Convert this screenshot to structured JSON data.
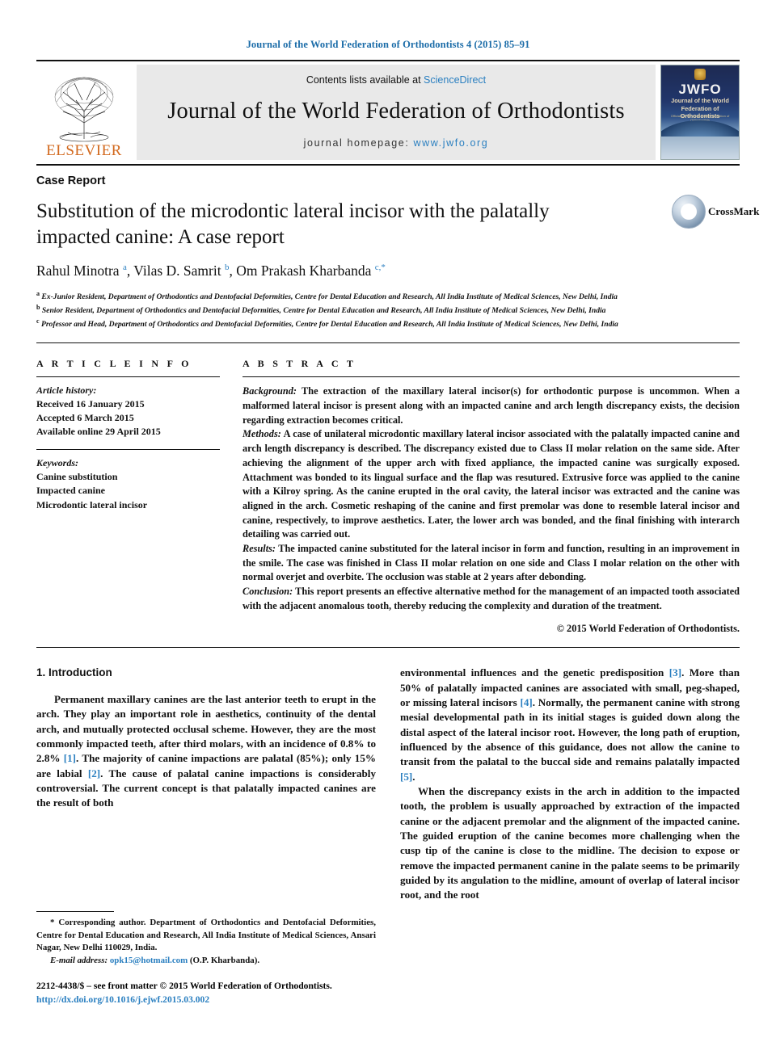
{
  "running_head": "Journal of the World Federation of Orthodontists 4 (2015) 85–91",
  "masthead": {
    "contents_prefix": "Contents lists available at ",
    "contents_link": "ScienceDirect",
    "journal_name": "Journal of the World Federation of Orthodontists",
    "homepage_prefix": "journal homepage: ",
    "homepage_url": "www.jwfo.org",
    "publisher_logo_text": "ELSEVIER",
    "cover": {
      "acronym": "JWFO",
      "line1": "Journal of the World",
      "line2": "Federation of Orthodontists",
      "line3": "Official journal of the World Federation of Orthodontists"
    }
  },
  "article": {
    "type_label": "Case Report",
    "title": "Substitution of the microdontic lateral incisor with the palatally impacted canine: A case report",
    "authors_html": "Rahul Minotra <sup>a</sup>, Vilas D. Samrit <sup>b</sup>, Om Prakash Kharbanda <sup>c,</sup><sup>*</sup>",
    "crossmark_label": "CrossMark",
    "affiliations": [
      "Ex-Junior Resident, Department of Orthodontics and Dentofacial Deformities, Centre for Dental Education and Research, All India Institute of Medical Sciences, New Delhi, India",
      "Senior Resident, Department of Orthodontics and Dentofacial Deformities, Centre for Dental Education and Research, All India Institute of Medical Sciences, New Delhi, India",
      "Professor and Head, Department of Orthodontics and Dentofacial Deformities, Centre for Dental Education and Research, All India Institute of Medical Sciences, New Delhi, India"
    ],
    "affiliation_markers": [
      "a",
      "b",
      "c"
    ]
  },
  "article_info": {
    "heading": "A R T I C L E  I N F O",
    "history_label": "Article history:",
    "history": [
      "Received 16 January 2015",
      "Accepted 6 March 2015",
      "Available online 29 April 2015"
    ],
    "keywords_label": "Keywords:",
    "keywords": [
      "Canine substitution",
      "Impacted canine",
      "Microdontic lateral incisor"
    ]
  },
  "abstract": {
    "heading": "A B S T R A C T",
    "background_label": "Background:",
    "background_text": " The extraction of the maxillary lateral incisor(s) for orthodontic purpose is uncommon. When a malformed lateral incisor is present along with an impacted canine and arch length discrepancy exists, the decision regarding extraction becomes critical.",
    "methods_label": "Methods:",
    "methods_text": " A case of unilateral microdontic maxillary lateral incisor associated with the palatally impacted canine and arch length discrepancy is described. The discrepancy existed due to Class II molar relation on the same side. After achieving the alignment of the upper arch with fixed appliance, the impacted canine was surgically exposed. Attachment was bonded to its lingual surface and the flap was resutured. Extrusive force was applied to the canine with a Kilroy spring. As the canine erupted in the oral cavity, the lateral incisor was extracted and the canine was aligned in the arch. Cosmetic reshaping of the canine and first premolar was done to resemble lateral incisor and canine, respectively, to improve aesthetics. Later, the lower arch was bonded, and the final finishing with interarch detailing was carried out.",
    "results_label": "Results:",
    "results_text": " The impacted canine substituted for the lateral incisor in form and function, resulting in an improvement in the smile. The case was finished in Class II molar relation on one side and Class I molar relation on the other with normal overjet and overbite. The occlusion was stable at 2 years after debonding.",
    "conclusion_label": "Conclusion:",
    "conclusion_text": " This report presents an effective alternative method for the management of an impacted tooth associated with the adjacent anomalous tooth, thereby reducing the complexity and duration of the treatment.",
    "copyright": "© 2015 World Federation of Orthodontists."
  },
  "body": {
    "section_number_title": "1.  Introduction",
    "left_paragraph": "Permanent maxillary canines are the last anterior teeth to erupt in the arch. They play an important role in aesthetics, continuity of the dental arch, and mutually protected occlusal scheme. However, they are the most commonly impacted teeth, after third molars, with an incidence of 0.8% to 2.8% ",
    "left_ref1": "[1]",
    "left_paragraph_b": ". The majority of canine impactions are palatal (85%); only 15% are labial ",
    "left_ref2": "[2]",
    "left_paragraph_c": ". The cause of palatal canine impactions is considerably controversial. The current concept is that palatally impacted canines are the result of both",
    "right_paragraph_a": "environmental influences and the genetic predisposition ",
    "right_ref3": "[3]",
    "right_paragraph_b": ". More than 50% of palatally impacted canines are associated with small, peg-shaped, or missing lateral incisors ",
    "right_ref4": "[4]",
    "right_paragraph_c": ". Normally, the permanent canine with strong mesial developmental path in its initial stages is guided down along the distal aspect of the lateral incisor root. However, the long path of eruption, influenced by the absence of this guidance, does not allow the canine to transit from the palatal to the buccal side and remains palatally impacted ",
    "right_ref5": "[5]",
    "right_paragraph_d": ".",
    "right_paragraph2": "When the discrepancy exists in the arch in addition to the impacted tooth, the problem is usually approached by extraction of the impacted canine or the adjacent premolar and the alignment of the impacted canine. The guided eruption of the canine becomes more challenging when the cusp tip of the canine is close to the midline. The decision to expose or remove the impacted permanent canine in the palate seems to be primarily guided by its angulation to the midline, amount of overlap of lateral incisor root, and the root"
  },
  "footnotes": {
    "corresponding_marker": "*",
    "corresponding_text": " Corresponding author. Department of Orthodontics and Dentofacial Deformities, Centre for Dental Education and Research, All India Institute of Medical Sciences, Ansari Nagar, New Delhi 110029, India.",
    "email_label": "E-mail address:",
    "email": "opk15@hotmail.com",
    "email_suffix": " (O.P. Kharbanda).",
    "issn_line": "2212-4438/$ – see front matter © 2015 World Federation of Orthodontists.",
    "doi": "http://dx.doi.org/10.1016/j.ejwf.2015.03.002"
  },
  "colors": {
    "link_blue": "#2a7fc0",
    "running_head_blue": "#1b6ca8",
    "elsevier_orange": "#d2691e"
  }
}
